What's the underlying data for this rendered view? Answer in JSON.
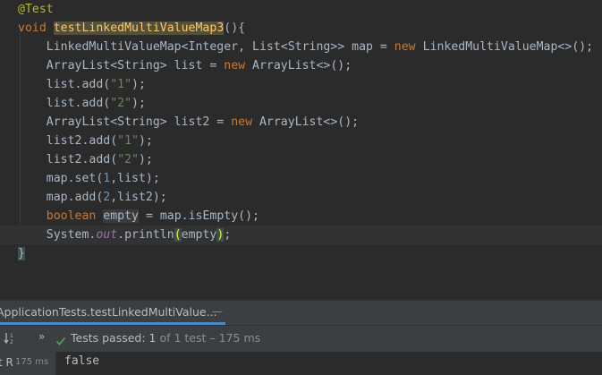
{
  "editor": {
    "lines": [
      {
        "tokens": [
          {
            "t": "@Test",
            "c": "tok-ann"
          }
        ]
      },
      {
        "tokens": [
          {
            "t": "void ",
            "c": "tok-kw"
          },
          {
            "t": "testLinkedMultiValueMap3",
            "c": "tok-hl-fn"
          },
          {
            "t": "(){",
            "c": "tok-plain"
          }
        ]
      },
      {
        "tokens": [
          {
            "t": "    LinkedMultiValueMap<Integer, List<String>> map = ",
            "c": "tok-plain"
          },
          {
            "t": "new ",
            "c": "tok-kw"
          },
          {
            "t": "LinkedMultiValueMap<>();",
            "c": "tok-plain"
          }
        ]
      },
      {
        "tokens": [
          {
            "t": "    ArrayList<String> list = ",
            "c": "tok-plain"
          },
          {
            "t": "new ",
            "c": "tok-kw"
          },
          {
            "t": "ArrayList<>();",
            "c": "tok-plain"
          }
        ]
      },
      {
        "tokens": [
          {
            "t": "    list.add(",
            "c": "tok-plain"
          },
          {
            "t": "\"1\"",
            "c": "tok-str"
          },
          {
            "t": ");",
            "c": "tok-plain"
          }
        ]
      },
      {
        "tokens": [
          {
            "t": "    list.add(",
            "c": "tok-plain"
          },
          {
            "t": "\"2\"",
            "c": "tok-str"
          },
          {
            "t": ");",
            "c": "tok-plain"
          }
        ]
      },
      {
        "tokens": [
          {
            "t": "    ArrayList<String> list2 = ",
            "c": "tok-plain"
          },
          {
            "t": "new ",
            "c": "tok-kw"
          },
          {
            "t": "ArrayList<>();",
            "c": "tok-plain"
          }
        ]
      },
      {
        "tokens": [
          {
            "t": "    list2.add(",
            "c": "tok-plain"
          },
          {
            "t": "\"1\"",
            "c": "tok-str"
          },
          {
            "t": ");",
            "c": "tok-plain"
          }
        ]
      },
      {
        "tokens": [
          {
            "t": "    list2.add(",
            "c": "tok-plain"
          },
          {
            "t": "\"2\"",
            "c": "tok-str"
          },
          {
            "t": ");",
            "c": "tok-plain"
          }
        ]
      },
      {
        "tokens": [
          {
            "t": "    map.set(",
            "c": "tok-plain"
          },
          {
            "t": "1",
            "c": "tok-num"
          },
          {
            "t": ",list);",
            "c": "tok-plain"
          }
        ]
      },
      {
        "tokens": [
          {
            "t": "    map.add(",
            "c": "tok-plain"
          },
          {
            "t": "2",
            "c": "tok-num"
          },
          {
            "t": ",list2);",
            "c": "tok-plain"
          }
        ]
      },
      {
        "tokens": [
          {
            "t": "    ",
            "c": "tok-plain"
          },
          {
            "t": "boolean ",
            "c": "tok-kw"
          },
          {
            "t": "empty",
            "c": "tok-hl-var"
          },
          {
            "t": " = map.isEmpty();",
            "c": "tok-plain"
          }
        ]
      },
      {
        "current": true,
        "tokens": [
          {
            "t": "    System.",
            "c": "tok-plain"
          },
          {
            "t": "out",
            "c": "tok-field"
          },
          {
            "t": ".println",
            "c": "tok-plain"
          },
          {
            "t": "(",
            "c": "tok-paren-match"
          },
          {
            "t": "empty",
            "c": "tok-plain"
          },
          {
            "t": ")",
            "c": "tok-paren-match"
          },
          {
            "t": ";",
            "c": "tok-plain"
          }
        ]
      },
      {
        "tokens": [
          {
            "t": "}",
            "c": "tok-brace"
          }
        ]
      }
    ]
  },
  "run_panel": {
    "tab_label": "ApplicationTests.testLinkedMultiValue...",
    "tab_close": "—",
    "sort_icon": "sort-icon",
    "expand_label": "»",
    "check_icon": "check-icon",
    "status_text": "Tests passed: 1",
    "status_detail": " of 1 test – 175 ms",
    "tree_label": "t R",
    "tree_time": "175 ms",
    "console_output": "false",
    "colors": {
      "accent": "#4a88c7",
      "pass": "#499c54"
    }
  }
}
